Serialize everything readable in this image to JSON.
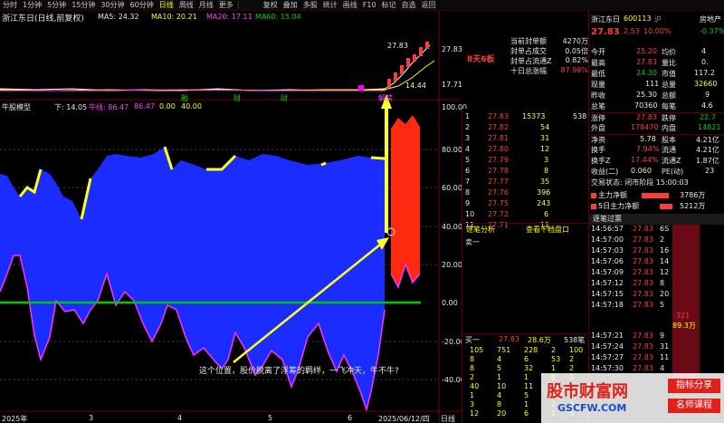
{
  "toolbar": {
    "periods": [
      "分时",
      "1分钟",
      "5分钟",
      "15分钟",
      "30分钟",
      "60分钟",
      "日线",
      "周线",
      "月线",
      "更多"
    ],
    "active_period": "日线",
    "right_buttons": [
      "复权",
      "叠加",
      "多股",
      "统计",
      "画线",
      "F10",
      "标记",
      "自选",
      "返回"
    ]
  },
  "kchart": {
    "stock_title": "浙江东日(日线,前复权)",
    "ma5_label": "MA5: 24.32",
    "ma10_label": "MA10: 20.21",
    "ma20_label": "MA20: 17.11",
    "ma60_label": "MA60: 15.04",
    "high_price": "27.83",
    "low_price": "14.44",
    "ytick_top": "27.83",
    "ytick_mid": "17.71",
    "event_labels": [
      "融",
      "财",
      "财",
      "解禁"
    ]
  },
  "limit_info": {
    "board_label": "8天6板",
    "rows": [
      {
        "label": "当前封单额",
        "value": "4270万"
      },
      {
        "label": "封单占成交",
        "value": "0.05倍"
      },
      {
        "label": "封单占流通Z",
        "value": "0.82%"
      },
      {
        "label": "十日总涨幅",
        "value": "87.98%"
      }
    ]
  },
  "indicator": {
    "title": "牛股模型",
    "subtitle": "下: 14.05",
    "params": [
      "牛线: 86.47",
      "86.47",
      "0.00",
      "40.00"
    ],
    "yticks": [
      "100.00",
      "80.00",
      "60.00",
      "40.00",
      "20.00",
      "0.00",
      "-20.00",
      "-40.00"
    ],
    "annotation": "这个位置，股价脱离了浮筹的羁绊，一飞冲天，牛不牛?",
    "date_label": "2025/06/12/四",
    "day_label": "日线",
    "x_labels": [
      "2025年",
      "3",
      "4",
      "5",
      "6"
    ]
  },
  "quote": {
    "stock_name": "浙江东日",
    "stock_code": "600113",
    "tag": "沪",
    "price": "27.83",
    "change": "2.53",
    "change_pct": "10.00%",
    "sector": "房地产",
    "sector_pct": "-0.37%",
    "rows": [
      {
        "l1": "今开",
        "v1": "25.20",
        "l2": "均价",
        "v2": "4"
      },
      {
        "l1": "最高",
        "v1": "27.83",
        "l2": "量比",
        "v2": "0."
      },
      {
        "l1": "最低",
        "v1": "24.30",
        "l2": "市值",
        "v2": "117.2"
      },
      {
        "l1": "现量",
        "v1": "111",
        "l2": "总量",
        "v2": "32660"
      },
      {
        "l1": "昨收",
        "v1": "25.30",
        "l2": "总额",
        "v2": "9"
      },
      {
        "l1": "总笔",
        "v1": "70360",
        "l2": "每笔",
        "v2": "4.6"
      },
      {
        "l1": "涨停",
        "v1": "27.83",
        "l2": "跌停",
        "v2": "22.7"
      },
      {
        "l1": "外盘",
        "v1": "178470",
        "l2": "内盘",
        "v2": "14821"
      },
      {
        "l1": "净资",
        "v1": "5.78",
        "l2": "股本",
        "v2": "4.21亿"
      },
      {
        "l1": "换手",
        "v1": "7.94%",
        "l2": "流通",
        "v2": "4.21亿"
      },
      {
        "l1": "换手Z",
        "v1": "17.44%",
        "l2": "流通Z",
        "v2": "1.87亿"
      },
      {
        "l1": "收益(二)",
        "v1": "0.060",
        "l2": "PE(动)",
        "v2": "23"
      }
    ],
    "trade_status": "交易状态: 闭市阶段 15:00:03",
    "main_flow_label": "主力净额",
    "main_flow_value": "3786万",
    "five_day_label": "5日主力净额",
    "five_day_value": "5212万",
    "tick_tab": "逐笔过票",
    "tick_rows": [
      {
        "time": "14:56:57",
        "price": "27.83",
        "vol": "6S"
      },
      {
        "time": "14:57:00",
        "price": "27.83",
        "vol": "2"
      },
      {
        "time": "14:57:03",
        "price": "27.83",
        "vol": "16"
      },
      {
        "time": "14:57:06",
        "price": "27.83",
        "vol": "14"
      },
      {
        "time": "14:57:09",
        "price": "27.83",
        "vol": "12"
      },
      {
        "time": "14:57:12",
        "price": "27.83",
        "vol": "8"
      },
      {
        "time": "14:57:15",
        "price": "27.83",
        "vol": "20"
      },
      {
        "time": "14:57:18",
        "price": "27.83",
        "vol": "5"
      },
      {
        "time": "14:57:21",
        "price": "27.83",
        "vol": "9"
      },
      {
        "time": "14:57:24",
        "price": "27.83",
        "vol": "31"
      },
      {
        "time": "14:57:27",
        "price": "27.83",
        "vol": "11"
      },
      {
        "time": "14:57:30",
        "price": "27.83",
        "vol": "4"
      }
    ],
    "big_order": "321",
    "big_amount": "89.3万",
    "watermark_main": "股市财富网",
    "watermark_url": "GSCFW.COM",
    "watermark_tag1": "指标分享",
    "watermark_tag2": "名师课程"
  },
  "book": {
    "header_value": "538",
    "bids": [
      {
        "n": "1",
        "price": "27.83",
        "vol": "15373"
      },
      {
        "n": "2",
        "price": "27.82",
        "vol": "54"
      },
      {
        "n": "3",
        "price": "27.81",
        "vol": "31"
      },
      {
        "n": "4",
        "price": "27.80",
        "vol": "12"
      },
      {
        "n": "5",
        "price": "27.79",
        "vol": "3"
      },
      {
        "n": "6",
        "price": "27.78",
        "vol": "8"
      },
      {
        "n": "7",
        "price": "27.77",
        "vol": "35"
      },
      {
        "n": "8",
        "price": "27.76",
        "vol": "396"
      },
      {
        "n": "9",
        "price": "27.75",
        "vol": "243"
      },
      {
        "n": "10",
        "price": "27.72",
        "vol": "6"
      },
      {
        "n": "11",
        "price": "27.71",
        "vol": "11"
      }
    ],
    "tab1": "逐笔分析",
    "tab2": "查看千档盘口",
    "sell_label": "卖一",
    "buy_label": "买一",
    "buy_price": "27.83",
    "buy_vol": "28.6万",
    "buy_count": "538笔",
    "queue": [
      [
        "105",
        "751",
        "228",
        "2",
        "100"
      ],
      [
        "8",
        "4",
        "6",
        "53",
        "2"
      ],
      [
        "8",
        "5",
        "32",
        "1",
        "2"
      ],
      [
        "2",
        "1",
        "1",
        "8",
        "2"
      ],
      [
        "40",
        "10",
        "11",
        "5",
        "2"
      ],
      [
        "1",
        "4",
        "5",
        "1",
        "2"
      ],
      [
        "3",
        "8",
        "1",
        "2",
        "2"
      ],
      [
        "12",
        "20",
        "6",
        "1",
        "5"
      ]
    ]
  },
  "colors": {
    "up": "#ff3c3c",
    "down": "#00d200",
    "indicator_fill": "#1a2cff",
    "limit_fill": "#ff2a10",
    "outline": "#ff30ff",
    "baseline": "#00c800",
    "arrow": "#ffff20"
  }
}
